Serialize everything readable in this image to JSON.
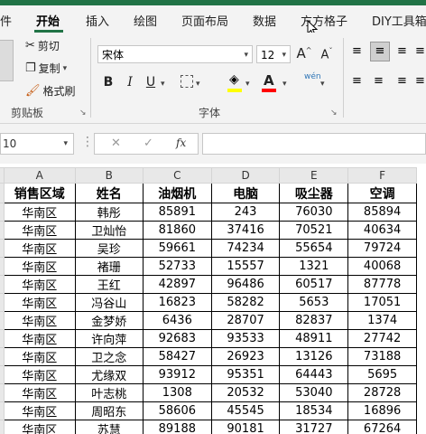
{
  "ribbon_tabs": [
    "件",
    "开始",
    "插入",
    "绘图",
    "页面布局",
    "数据",
    "方方格子",
    "DIY工具箱"
  ],
  "clipboard": {
    "cut": "剪切",
    "copy": "复制",
    "format_painter": "格式刷",
    "label": "剪贴板"
  },
  "font": {
    "name": "宋体",
    "size": "12",
    "label": "字体",
    "grow": "A",
    "shrink": "A",
    "bold": "B",
    "italic": "I",
    "underline": "U",
    "phonetic": "wén"
  },
  "formula_bar": {
    "name_box": "10",
    "fx": "fx",
    "cancel": "✕",
    "confirm": "✓"
  },
  "columns": [
    "A",
    "B",
    "C",
    "D",
    "E",
    "F"
  ],
  "header": [
    "销售区域",
    "姓名",
    "油烟机",
    "电脑",
    "吸尘器",
    "空调"
  ],
  "rows": [
    [
      "华南区",
      "韩彤",
      "85891",
      "243",
      "76030",
      "85894"
    ],
    [
      "华南区",
      "卫灿怡",
      "81860",
      "37416",
      "70521",
      "40634"
    ],
    [
      "华南区",
      "吴珍",
      "59661",
      "74234",
      "55654",
      "79724"
    ],
    [
      "华南区",
      "褚珊",
      "52733",
      "15557",
      "1321",
      "40068"
    ],
    [
      "华南区",
      "王红",
      "42897",
      "96486",
      "60517",
      "87778"
    ],
    [
      "华南区",
      "冯谷山",
      "16823",
      "58282",
      "5653",
      "17051"
    ],
    [
      "华南区",
      "金梦娇",
      "6436",
      "28707",
      "82837",
      "1374"
    ],
    [
      "华南区",
      "许向萍",
      "92683",
      "93533",
      "48911",
      "27742"
    ],
    [
      "华南区",
      "卫之念",
      "58427",
      "26923",
      "13126",
      "73188"
    ],
    [
      "华南区",
      "尤缘双",
      "93912",
      "95351",
      "64443",
      "5695"
    ],
    [
      "华南区",
      "叶志桃",
      "1308",
      "20532",
      "53040",
      "28728"
    ],
    [
      "华南区",
      "周昭东",
      "58606",
      "45545",
      "18534",
      "16896"
    ],
    [
      "华南区",
      "苏慧",
      "89188",
      "90181",
      "31727",
      "67264"
    ]
  ]
}
